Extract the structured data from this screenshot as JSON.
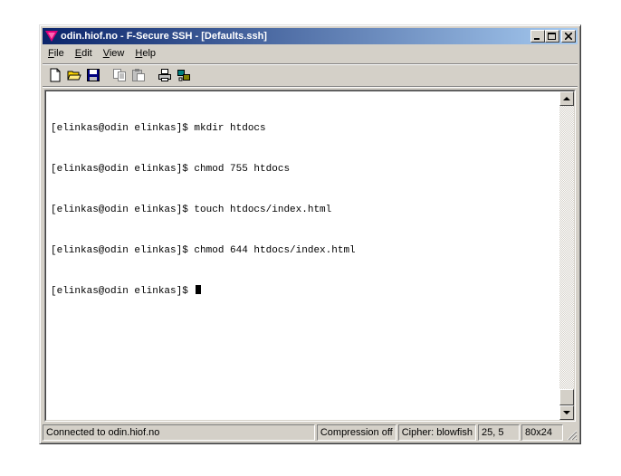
{
  "window": {
    "title": "odin.hiof.no - F-Secure SSH - [Defaults.ssh]"
  },
  "menu": {
    "file_underline": "F",
    "file_rest": "ile",
    "edit_underline": "E",
    "edit_rest": "dit",
    "view_underline": "V",
    "view_rest": "iew",
    "help_underline": "H",
    "help_rest": "elp"
  },
  "toolbar": {
    "icons": [
      "new-file-icon",
      "open-folder-icon",
      "save-icon",
      "copy-icon",
      "paste-icon",
      "print-icon",
      "properties-icon"
    ]
  },
  "terminal": {
    "lines": [
      "[elinkas@odin elinkas]$ mkdir htdocs",
      "[elinkas@odin elinkas]$ chmod 755 htdocs",
      "[elinkas@odin elinkas]$ touch htdocs/index.html",
      "[elinkas@odin elinkas]$ chmod 644 htdocs/index.html",
      "[elinkas@odin elinkas]$"
    ]
  },
  "status": {
    "connection": "Connected to odin.hiof.no",
    "compression": "Compression off",
    "cipher": "Cipher: blowfish",
    "cursor_pos": "25, 5",
    "size": "80x24"
  },
  "colors": {
    "title_start": "#0a246a",
    "title_end": "#a6caf0",
    "face": "#d4d0c8"
  }
}
